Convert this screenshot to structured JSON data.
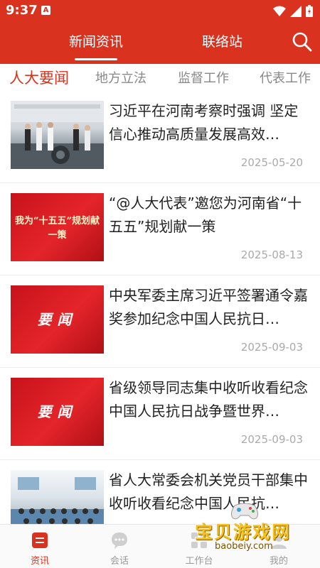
{
  "status_bar": {
    "time": "9:37",
    "app_icon_letter": "A"
  },
  "header": {
    "tabs": [
      {
        "label": "新闻资讯",
        "active": true
      },
      {
        "label": "联络站",
        "active": false
      }
    ]
  },
  "categories": [
    {
      "label": "人大要闻",
      "active": true
    },
    {
      "label": "地方立法",
      "active": false
    },
    {
      "label": "监督工作",
      "active": false
    },
    {
      "label": "代表工作",
      "active": false
    }
  ],
  "news": [
    {
      "title": "习近平在河南考察时强调 坚定信心推动高质量发展高效…",
      "date": "2025-05-20",
      "thumb": "photo-inspection"
    },
    {
      "title": "“@人大代表”邀您为河南省“十五五”规划献一策",
      "date": "2025-08-13",
      "thumb": "plan-banner",
      "thumb_text": "我为“十五五”规划献一策"
    },
    {
      "title": "中央军委主席习近平签署通令嘉奖参加纪念中国人民抗日…",
      "date": "2025-09-03",
      "thumb": "yaowen-banner",
      "thumb_text": "要闻"
    },
    {
      "title": "省级领导同志集中收听收看纪念中国人民抗日战争暨世界…",
      "date": "2025-09-03",
      "thumb": "yaowen-banner",
      "thumb_text": "要闻"
    },
    {
      "title": "省人大常委会机关党员干部集中收听收看纪念中国人民抗…",
      "date": "",
      "thumb": "photo-meeting"
    }
  ],
  "bottom_nav": [
    {
      "label": "资讯",
      "icon": "news-icon",
      "active": true
    },
    {
      "label": "会话",
      "icon": "chat-icon",
      "active": false
    },
    {
      "label": "工作台",
      "icon": "workbench-icon",
      "active": false
    },
    {
      "label": "我的",
      "icon": "profile-icon",
      "active": false
    }
  ],
  "watermark": {
    "text": "宝贝游戏网",
    "url": "baobeiy.com"
  },
  "colors": {
    "brand_red": "#d9321f",
    "inactive_gray": "#999999"
  }
}
